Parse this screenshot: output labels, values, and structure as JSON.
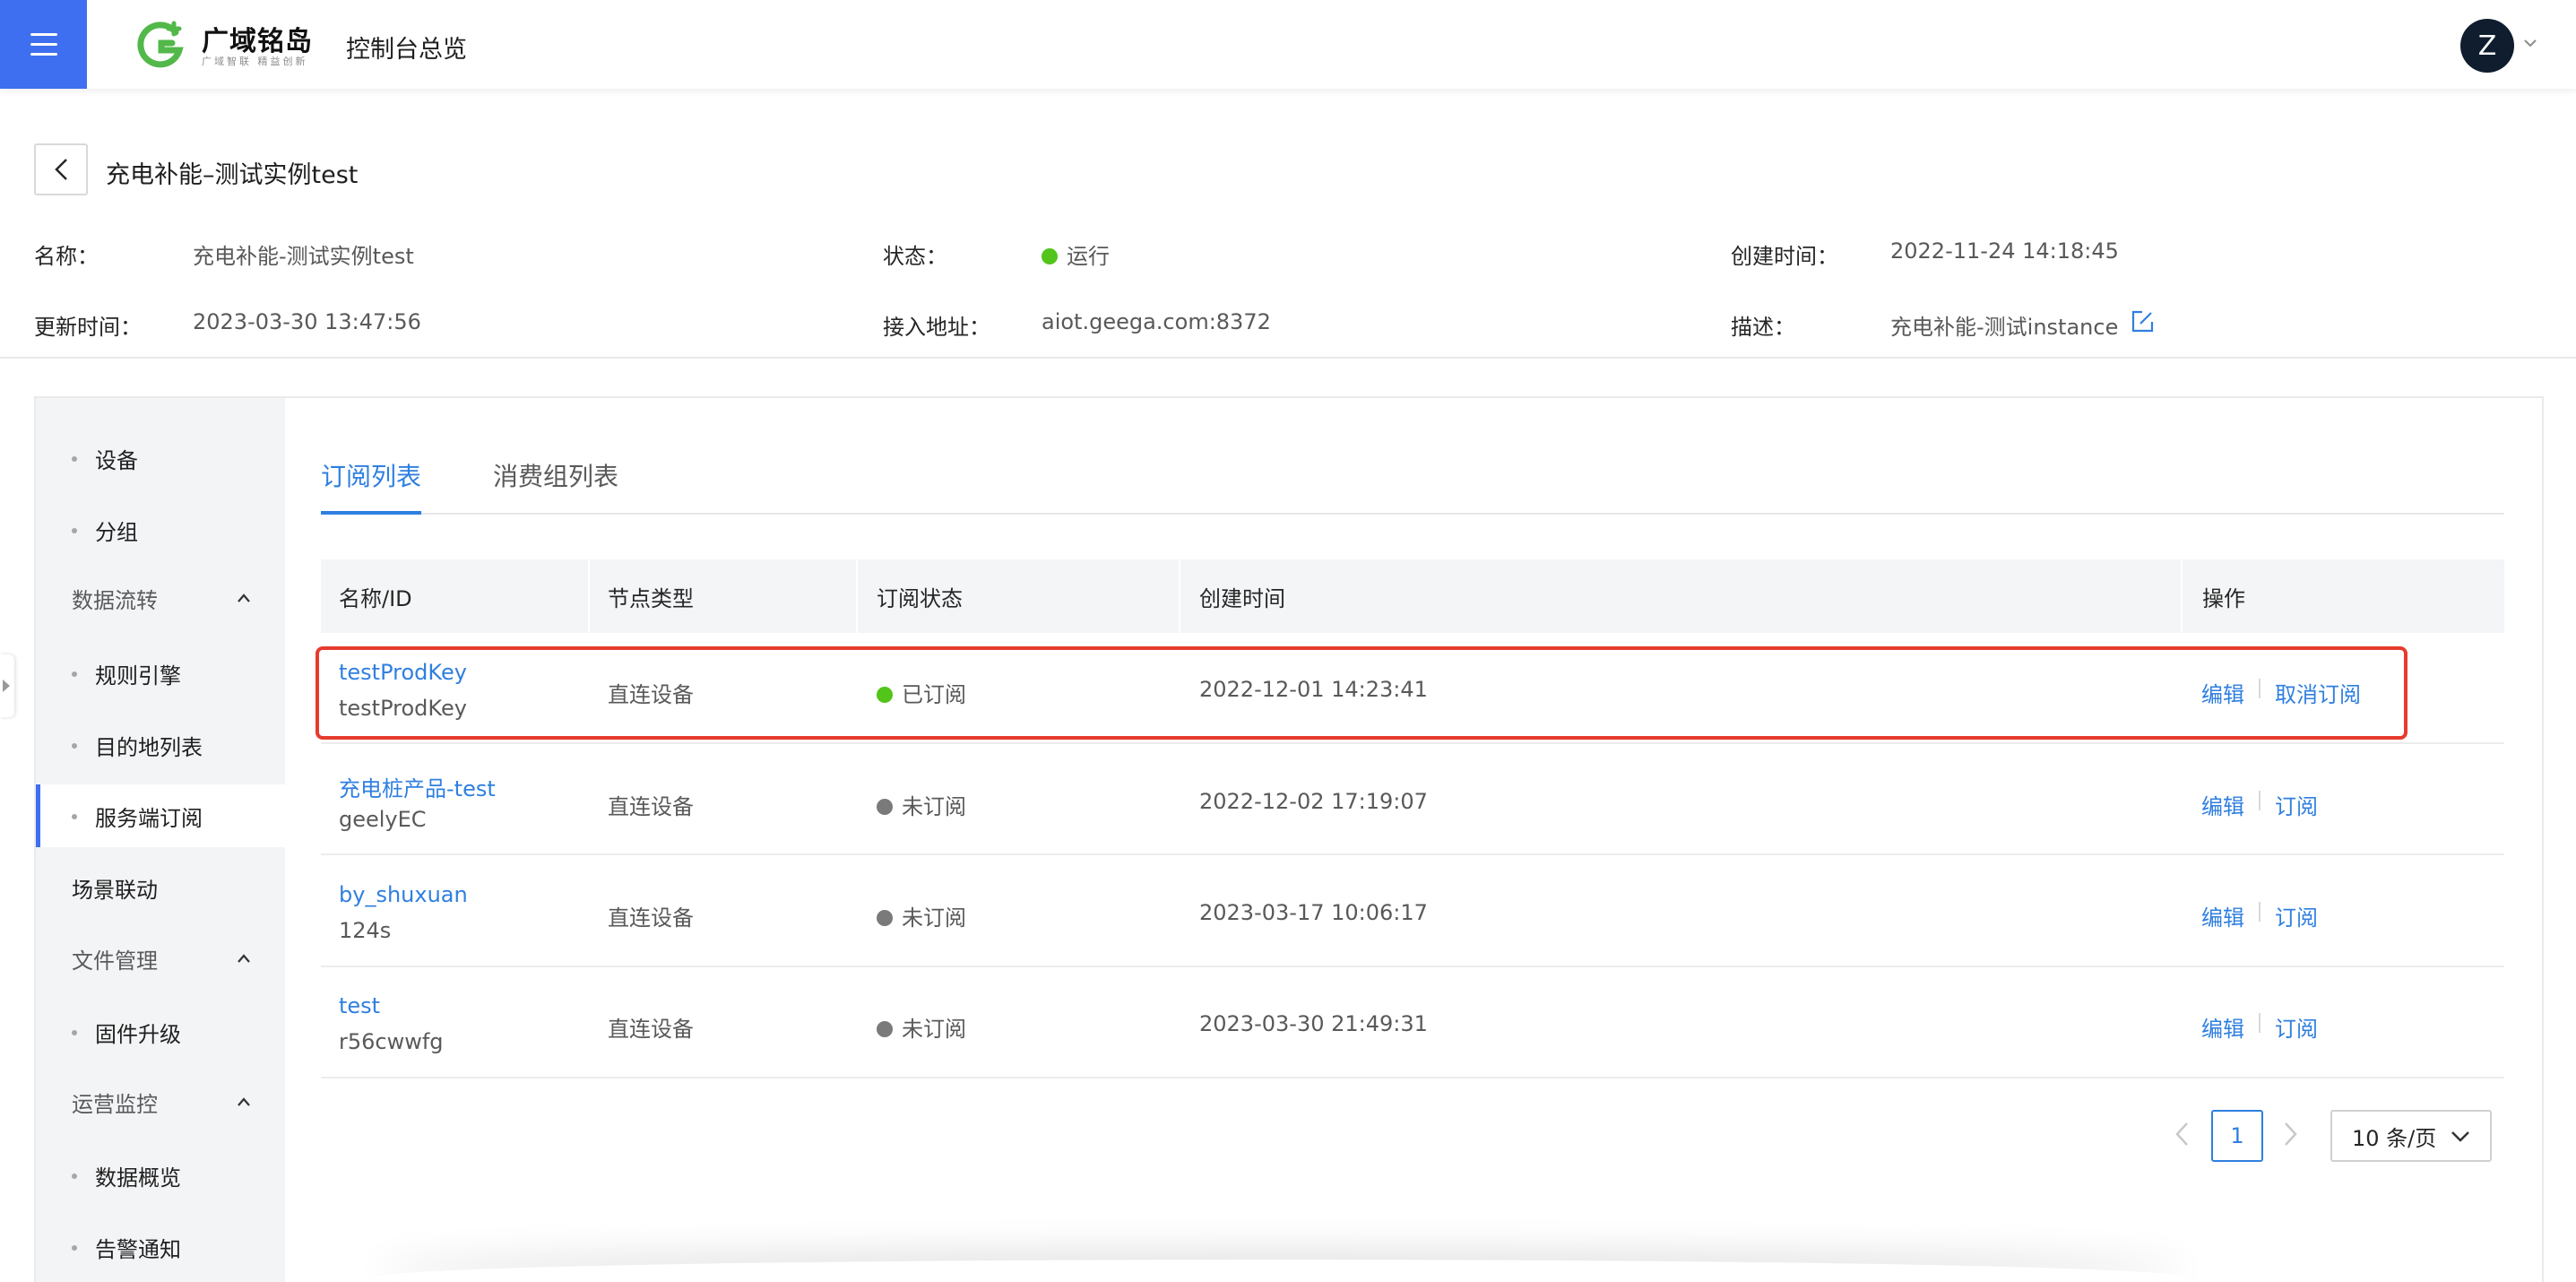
{
  "header": {
    "brand_name": "广域铭岛",
    "brand_tagline": "广域智联 精益创新",
    "console_title": "控制台总览",
    "avatar_initial": "Z"
  },
  "instance": {
    "title": "充电补能–测试实例test",
    "name_label": "名称：",
    "name_value": "充电补能-测试实例test",
    "status_label": "状态：",
    "status_value": "运行",
    "created_label": "创建时间：",
    "created_value": "2022-11-24 14:18:45",
    "updated_label": "更新时间：",
    "updated_value": "2023-03-30 13:47:56",
    "endpoint_label": "接入地址：",
    "endpoint_value": "aiot.geega.com:8372",
    "desc_label": "描述：",
    "desc_value": "充电补能-测试instance"
  },
  "sidebar": {
    "items": [
      {
        "label": "设备"
      },
      {
        "label": "分组"
      },
      {
        "label": "数据流转"
      },
      {
        "label": "规则引擎"
      },
      {
        "label": "目的地列表"
      },
      {
        "label": "服务端订阅"
      },
      {
        "label": "场景联动"
      },
      {
        "label": "文件管理"
      },
      {
        "label": "固件升级"
      },
      {
        "label": "运营监控"
      },
      {
        "label": "数据概览"
      },
      {
        "label": "告警通知"
      }
    ]
  },
  "tabs": [
    {
      "label": "订阅列表"
    },
    {
      "label": "消费组列表"
    }
  ],
  "table": {
    "headers": [
      "名称/ID",
      "节点类型",
      "订阅状态",
      "创建时间",
      "操作"
    ],
    "rows": [
      {
        "name": "testProdKey",
        "id": "testProdKey",
        "node_type": "直连设备",
        "status": "已订阅",
        "status_color": "#52c41a",
        "created": "2022-12-01 14:23:41",
        "action_edit": "编辑",
        "action_sub": "取消订阅"
      },
      {
        "name": "充电桩产品-test",
        "id": "geelyEC",
        "node_type": "直连设备",
        "status": "未订阅",
        "status_color": "#7a7a7a",
        "created": "2022-12-02 17:19:07",
        "action_edit": "编辑",
        "action_sub": "订阅"
      },
      {
        "name": "by_shuxuan",
        "id": "124s",
        "node_type": "直连设备",
        "status": "未订阅",
        "status_color": "#7a7a7a",
        "created": "2023-03-17 10:06:17",
        "action_edit": "编辑",
        "action_sub": "订阅"
      },
      {
        "name": "test",
        "id": "r56cwwfg",
        "node_type": "直连设备",
        "status": "未订阅",
        "status_color": "#7a7a7a",
        "created": "2023-03-30 21:49:31",
        "action_edit": "编辑",
        "action_sub": "订阅"
      }
    ]
  },
  "pagination": {
    "current_page": "1",
    "page_size": "10 条/页"
  },
  "colors": {
    "accent": "#2f7fe0",
    "menu_button": "#3e6ff0",
    "running": "#52c41a",
    "highlight_border": "#e63b2e"
  }
}
